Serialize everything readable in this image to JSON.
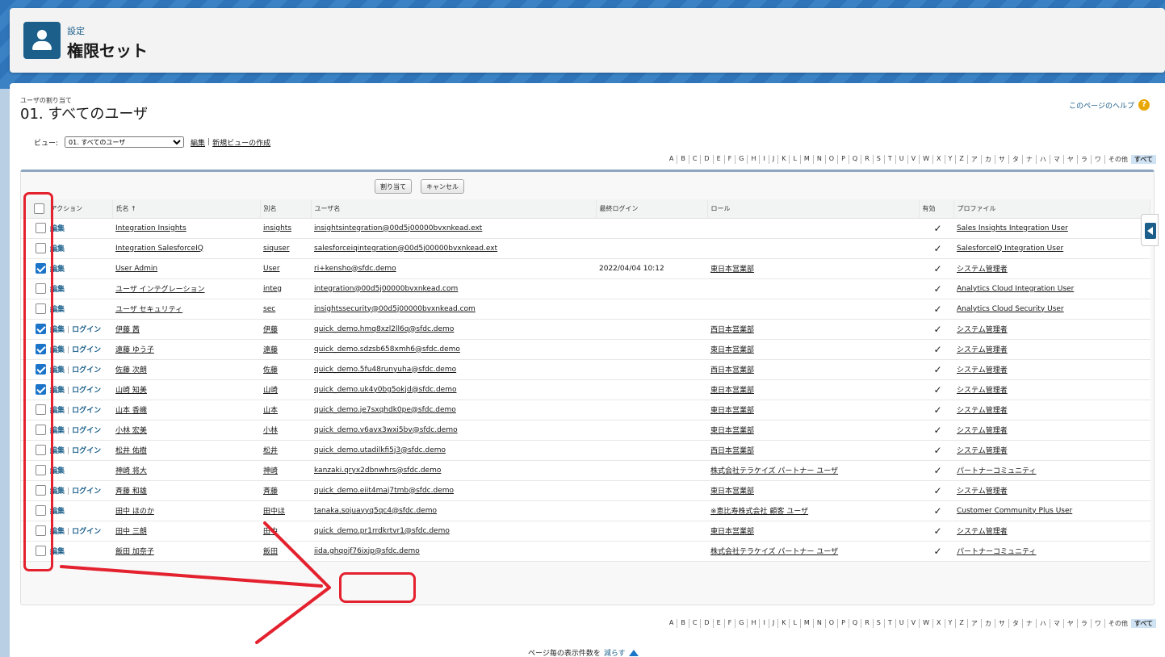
{
  "header": {
    "breadcrumb": "設定",
    "title": "権限セット"
  },
  "page": {
    "subtitle": "ユーザの割り当て",
    "title": "01. すべてのユーザ",
    "help_label": "このページのヘルプ",
    "help_icon": "?"
  },
  "view": {
    "label": "ビュー:",
    "selected": "01. すべてのユーザ",
    "edit_link": "編集",
    "divider": "|",
    "new_view_link": "新規ビューの作成"
  },
  "alpha": [
    "A",
    "B",
    "C",
    "D",
    "E",
    "F",
    "G",
    "H",
    "I",
    "J",
    "K",
    "L",
    "M",
    "N",
    "O",
    "P",
    "Q",
    "R",
    "S",
    "T",
    "U",
    "V",
    "W",
    "X",
    "Y",
    "Z",
    "ア",
    "カ",
    "サ",
    "タ",
    "ナ",
    "ハ",
    "マ",
    "ヤ",
    "ラ",
    "ワ",
    "その他",
    "すべて"
  ],
  "alpha_selected": "すべて",
  "buttons": {
    "assign": "割り当て",
    "cancel": "キャンセル"
  },
  "table": {
    "columns": [
      "アクション",
      "氏名 ↑",
      "別名",
      "ユーザ名",
      "最終ログイン",
      "ロール",
      "有効",
      "プロファイル"
    ],
    "rows": [
      {
        "checked": false,
        "edit": "編集",
        "login": "",
        "name": "Integration Insights",
        "alias": "insights",
        "username": "insightsintegration@00d5j00000bvxnkead.ext",
        "last_login": "",
        "role": "",
        "active": "✓",
        "profile": "Sales Insights Integration User"
      },
      {
        "checked": false,
        "edit": "編集",
        "login": "",
        "name": "Integration SalesforceIQ",
        "alias": "siquser",
        "username": "salesforceiqintegration@00d5j00000bvxnkead.ext",
        "last_login": "",
        "role": "",
        "active": "✓",
        "profile": "SalesforceIQ Integration User"
      },
      {
        "checked": true,
        "edit": "編集",
        "login": "",
        "name": "User Admin",
        "alias": "User",
        "username": "ri+kensho@sfdc.demo",
        "last_login": "2022/04/04 10:12",
        "role": "東日本営業部",
        "active": "✓",
        "profile": "システム管理者"
      },
      {
        "checked": false,
        "edit": "編集",
        "login": "",
        "name": "ユーザ インテグレーション",
        "alias": "integ",
        "username": "integration@00d5j00000bvxnkead.com",
        "last_login": "",
        "role": "",
        "active": "✓",
        "profile": "Analytics Cloud Integration User"
      },
      {
        "checked": false,
        "edit": "編集",
        "login": "",
        "name": "ユーザ セキュリティ",
        "alias": "sec",
        "username": "insightssecurity@00d5j00000bvxnkead.com",
        "last_login": "",
        "role": "",
        "active": "✓",
        "profile": "Analytics Cloud Security User"
      },
      {
        "checked": true,
        "edit": "編集",
        "login": "ログイン",
        "name": "伊藤 茜",
        "alias": "伊藤",
        "username": "quick_demo.hmq8xzl2ll6q@sfdc.demo",
        "last_login": "",
        "role": "西日本営業部",
        "active": "✓",
        "profile": "システム管理者"
      },
      {
        "checked": true,
        "edit": "編集",
        "login": "ログイン",
        "name": "遠藤 ゆう子",
        "alias": "遠藤",
        "username": "quick_demo.sdzsb658xmh6@sfdc.demo",
        "last_login": "",
        "role": "東日本営業部",
        "active": "✓",
        "profile": "システム管理者"
      },
      {
        "checked": true,
        "edit": "編集",
        "login": "ログイン",
        "name": "佐藤 次朗",
        "alias": "佐藤",
        "username": "quick_demo.5fu48runyuha@sfdc.demo",
        "last_login": "",
        "role": "西日本営業部",
        "active": "✓",
        "profile": "システム管理者"
      },
      {
        "checked": true,
        "edit": "編集",
        "login": "ログイン",
        "name": "山崎 知美",
        "alias": "山崎",
        "username": "quick_demo.uk4y0bg5okjd@sfdc.demo",
        "last_login": "",
        "role": "東日本営業部",
        "active": "✓",
        "profile": "システム管理者"
      },
      {
        "checked": false,
        "edit": "編集",
        "login": "ログイン",
        "name": "山本 香織",
        "alias": "山本",
        "username": "quick_demo.je7sxqhdk0pe@sfdc.demo",
        "last_login": "",
        "role": "東日本営業部",
        "active": "✓",
        "profile": "システム管理者"
      },
      {
        "checked": false,
        "edit": "編集",
        "login": "ログイン",
        "name": "小林 宏美",
        "alias": "小林",
        "username": "quick_demo.v6avx3wxi5bv@sfdc.demo",
        "last_login": "",
        "role": "東日本営業部",
        "active": "✓",
        "profile": "システム管理者"
      },
      {
        "checked": false,
        "edit": "編集",
        "login": "ログイン",
        "name": "松井 佑樹",
        "alias": "松井",
        "username": "quick_demo.utadilkfi5j3@sfdc.demo",
        "last_login": "",
        "role": "西日本営業部",
        "active": "✓",
        "profile": "システム管理者"
      },
      {
        "checked": false,
        "edit": "編集",
        "login": "",
        "name": "神崎 将大",
        "alias": "神崎",
        "username": "kanzaki.qryx2dbnwhrs@sfdc.demo",
        "last_login": "",
        "role": "株式会社テラケイズ パートナー ユーザ",
        "active": "✓",
        "profile": "パートナーコミュニティ"
      },
      {
        "checked": false,
        "edit": "編集",
        "login": "ログイン",
        "name": "斉藤 和雄",
        "alias": "斉藤",
        "username": "quick_demo.eiit4maj7tmb@sfdc.demo",
        "last_login": "",
        "role": "東日本営業部",
        "active": "✓",
        "profile": "システム管理者"
      },
      {
        "checked": false,
        "edit": "編集",
        "login": "",
        "name": "田中 ほのか",
        "alias": "田中ほ",
        "username": "tanaka.sojuayyq5qc4@sfdc.demo",
        "last_login": "",
        "role": "※恵比寿株式会社 顧客 ユーザ",
        "active": "✓",
        "profile": "Customer Community Plus User"
      },
      {
        "checked": false,
        "edit": "編集",
        "login": "ログイン",
        "name": "田中 三朗",
        "alias": "田中",
        "username": "quick_demo.pr1rrdkrtvr1@sfdc.demo",
        "last_login": "",
        "role": "東日本営業部",
        "active": "✓",
        "profile": "システム管理者"
      },
      {
        "checked": false,
        "edit": "編集",
        "login": "",
        "name": "飯田 加奈子",
        "alias": "飯田",
        "username": "iida.ghqojf76ixjp@sfdc.demo",
        "last_login": "",
        "role": "株式会社テラケイズ パートナー ユーザ",
        "active": "✓",
        "profile": "パートナーコミュニティ"
      }
    ]
  },
  "pager": {
    "label": "ページ毎の表示件数を",
    "link": "減らす"
  },
  "colors": {
    "brand": "#1b5f8a",
    "annotation": "#e4212e",
    "checkbox_checked": "#1b74c8"
  }
}
